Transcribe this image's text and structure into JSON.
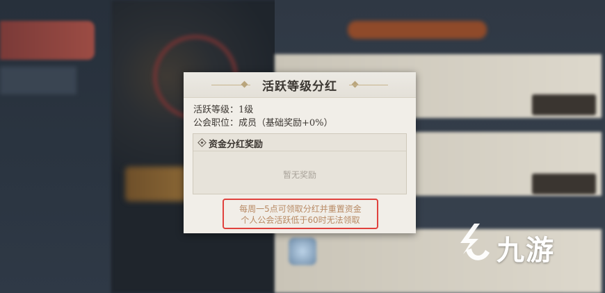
{
  "dialog": {
    "title": "活跃等级分红",
    "activity_level": "活跃等级：1级",
    "guild_position": "公会职位：成员（基础奖励+0%）",
    "reward_section": {
      "title": "资金分红奖励",
      "empty_text": "暂无奖励"
    },
    "notes": [
      "每周一5点可领取分红并重置资金",
      "个人公会活跃低于60时无法领取"
    ]
  },
  "watermark": {
    "text": "九游",
    "icon": "jiuyou-logo-icon"
  },
  "colors": {
    "dialog_bg": "#f1eee8",
    "note_text": "#b88a64",
    "note_highlight_border": "#e0413d"
  }
}
